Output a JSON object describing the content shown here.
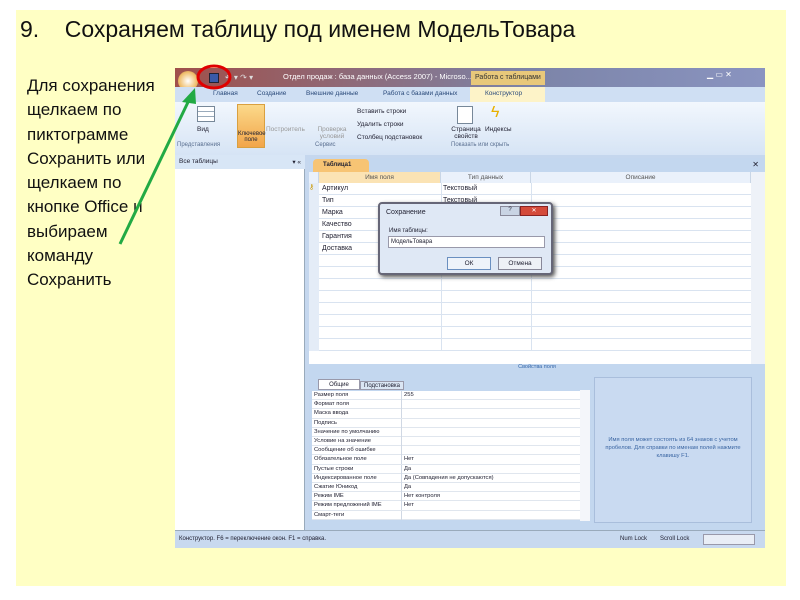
{
  "slide": {
    "title": "9.    Сохраняем таблицу под именем МодельТовара",
    "instruction": "Для сохранения щелкаем по пиктограмме Сохранить или щелкаем по кнопке Office и выбираем команду Сохранить",
    "highlight_color": "#e00000",
    "arrow_color": "#22aa44",
    "background": "#ffffc4"
  },
  "window": {
    "title": "Отдел продаж : база данных (Access 2007) - Microso...",
    "context_tab": "Работа с таблицами"
  },
  "ribbon": {
    "tabs": [
      "Главная",
      "Создание",
      "Внешние данные",
      "Работа с базами данных",
      "Конструктор"
    ],
    "view": "Вид",
    "key_field": "Ключевое поле",
    "builder": "Построитель",
    "test_rules": "Проверка условий",
    "insert_rows": "Вставить строки",
    "delete_rows": "Удалить строки",
    "lookup_column": "Столбец подстановок",
    "property_sheet": "Страница свойств",
    "indexes": "Индексы",
    "groups": [
      "Представления",
      "Сервис",
      "Показать или скрыть"
    ]
  },
  "nav": {
    "header": "Все таблицы"
  },
  "document": {
    "tab": "Таблица1",
    "columns": [
      "Имя поля",
      "Тип данных",
      "Описание"
    ],
    "rows": [
      {
        "name": "Артикул",
        "type": "Текстовый"
      },
      {
        "name": "Тип",
        "type": "Текстовый"
      },
      {
        "name": "Марка",
        "type": ""
      },
      {
        "name": "Качество",
        "type": ""
      },
      {
        "name": "Гарантия",
        "type": ""
      },
      {
        "name": "Доставка",
        "type": ""
      }
    ],
    "properties_label": "Свойства поля"
  },
  "dialog": {
    "title": "Сохранение",
    "label": "Имя таблицы:",
    "value": "МодельТовара",
    "ok": "ОК",
    "cancel": "Отмена"
  },
  "properties": {
    "tabs": [
      "Общие",
      "Подстановка"
    ],
    "rows": [
      [
        "Размер поля",
        "255"
      ],
      [
        "Формат поля",
        ""
      ],
      [
        "Маска ввода",
        ""
      ],
      [
        "Подпись",
        ""
      ],
      [
        "Значение по умолчанию",
        ""
      ],
      [
        "Условие на значение",
        ""
      ],
      [
        "Сообщение об ошибке",
        ""
      ],
      [
        "Обязательное поле",
        "Нет"
      ],
      [
        "Пустые строки",
        "Да"
      ],
      [
        "Индексированное поле",
        "Да (Совпадения не допускаются)"
      ],
      [
        "Сжатие Юникод",
        "Да"
      ],
      [
        "Режим IME",
        "Нет контроля"
      ],
      [
        "Режим предложений IME",
        "Нет"
      ],
      [
        "Смарт-теги",
        ""
      ]
    ],
    "help": "Имя поля может состоять из 64 знаков с учетом пробелов. Для справки по именам полей нажмите клавишу F1."
  },
  "status": {
    "left": "Конструктор.  F6 = переключение окон.  F1 = справка.",
    "num_lock": "Num Lock",
    "scroll_lock": "Scroll Lock"
  }
}
